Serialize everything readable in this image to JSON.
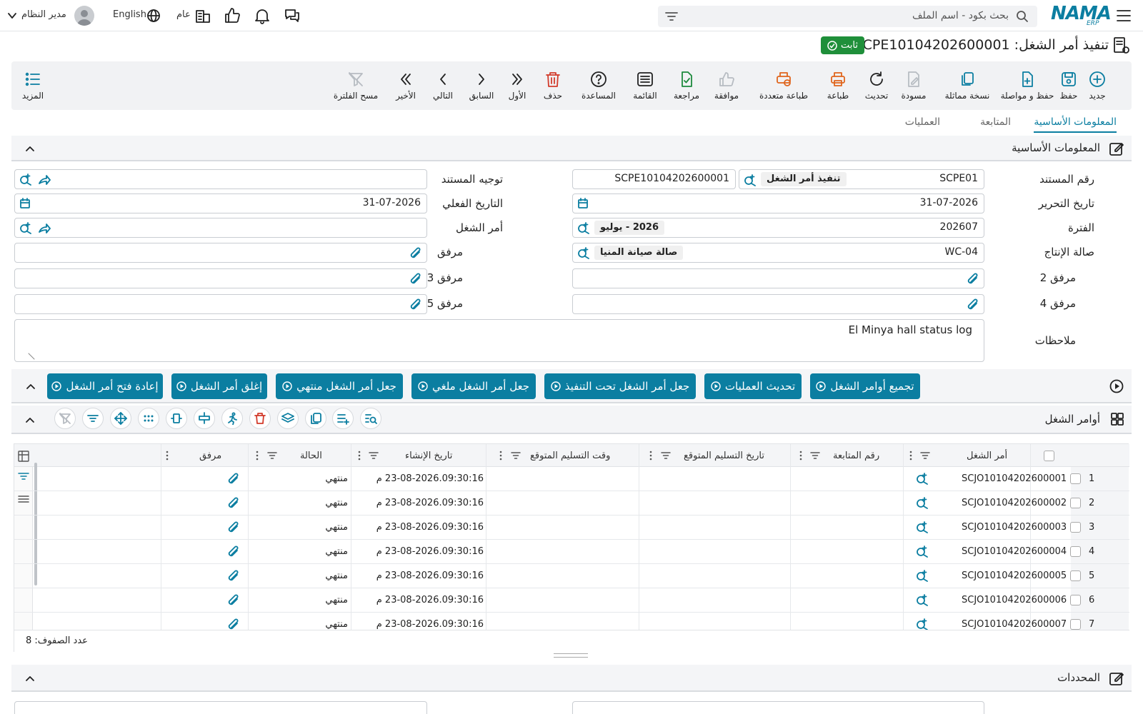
{
  "header": {
    "logo": "NAMA",
    "logo_sub": "ERP",
    "search_placeholder": "بحث بكود - اسم الملف",
    "language": "English",
    "branch": "عام",
    "user": "مدير النظام"
  },
  "page": {
    "title": "تنفيذ أمر الشغل: SCPE10104202600001",
    "status": "ثابت"
  },
  "toolbar": {
    "new": "جديد",
    "save": "حفظ",
    "save_continue": "حفظ و مواصلة",
    "duplicate": "نسخة مماثلة",
    "draft": "مسودة",
    "refresh": "تحديث",
    "print": "طباعة",
    "multi_print": "طباعة متعددة",
    "approve": "موافقة",
    "review": "مراجعة",
    "list": "القائمة",
    "help": "المساعدة",
    "delete": "حذف",
    "first": "الأول",
    "previous": "السابق",
    "next": "التالي",
    "last": "الأخير",
    "clear_filter": "مسح الفلترة",
    "more": "المزيد"
  },
  "tabs": [
    "المعلومات الأساسية",
    "المتابعة",
    "العمليات"
  ],
  "basic_section": {
    "title": "المعلومات الأساسية"
  },
  "form": {
    "doc_no_label": "رقم المستند",
    "doc_no_code": "SCPE01",
    "doc_no_type": "تنفيذ أمر الشغل",
    "doc_no_value": "SCPE10104202600001",
    "doc_routing_label": "توجيه المستند",
    "edit_date_label": "تاريخ التحرير",
    "edit_date": "31-07-2026",
    "actual_date_label": "التاريخ الفعلي",
    "actual_date": "31-07-2026",
    "period_label": "الفترة",
    "period_code": "202607",
    "period_name": "2026 - يوليو",
    "work_order_label": "أمر الشغل",
    "hall_label": "صالة الإنتاج",
    "hall_code": "WC-04",
    "hall_name": "صالة صيانة المنيا",
    "attach_label": "مرفق",
    "attach2_label": "مرفق 2",
    "attach3_label": "مرفق 3",
    "attach4_label": "مرفق 4",
    "attach5_label": "مرفق 5",
    "notes_label": "ملاحظات",
    "notes": "El Minya hall status log"
  },
  "actions": [
    "تجميع أوامر الشغل",
    "تحديث العمليات",
    "جعل أمر الشغل تحت التنفيذ",
    "جعل أمر الشغل ملغي",
    "جعل أمر الشغل منتهي",
    "إغلق أمر الشغل",
    "إعادة فتح أمر الشغل"
  ],
  "grid_section": {
    "title": "أوامر الشغل"
  },
  "grid": {
    "columns": {
      "work_order": "أمر الشغل",
      "follow_no": "رقم المتابعة",
      "expected_date": "تاريخ التسليم المتوقع",
      "expected_time": "وقت التسليم المتوقع",
      "created": "تاريخ الإنشاء",
      "status": "الحالة",
      "attachment": "مرفق"
    },
    "rows": [
      {
        "n": "1",
        "wo": "SCJO10104202600001",
        "created": "23-08-2026.09:30:16 م",
        "status": "منتهي"
      },
      {
        "n": "2",
        "wo": "SCJO10104202600002",
        "created": "23-08-2026.09:30:16 م",
        "status": "منتهي"
      },
      {
        "n": "3",
        "wo": "SCJO10104202600003",
        "created": "23-08-2026.09:30:16 م",
        "status": "منتهي"
      },
      {
        "n": "4",
        "wo": "SCJO10104202600004",
        "created": "23-08-2026.09:30:16 م",
        "status": "منتهي"
      },
      {
        "n": "5",
        "wo": "SCJO10104202600005",
        "created": "23-08-2026.09:30:16 م",
        "status": "منتهي"
      },
      {
        "n": "6",
        "wo": "SCJO10104202600006",
        "created": "23-08-2026.09:30:16 م",
        "status": "منتهي"
      },
      {
        "n": "7",
        "wo": "SCJO10104202600007",
        "created": "23-08-2026.09:30:16 م",
        "status": "منتهي"
      }
    ],
    "row_count": "عدد الصفوف: 8"
  },
  "dims_section": {
    "title": "المحددات"
  }
}
